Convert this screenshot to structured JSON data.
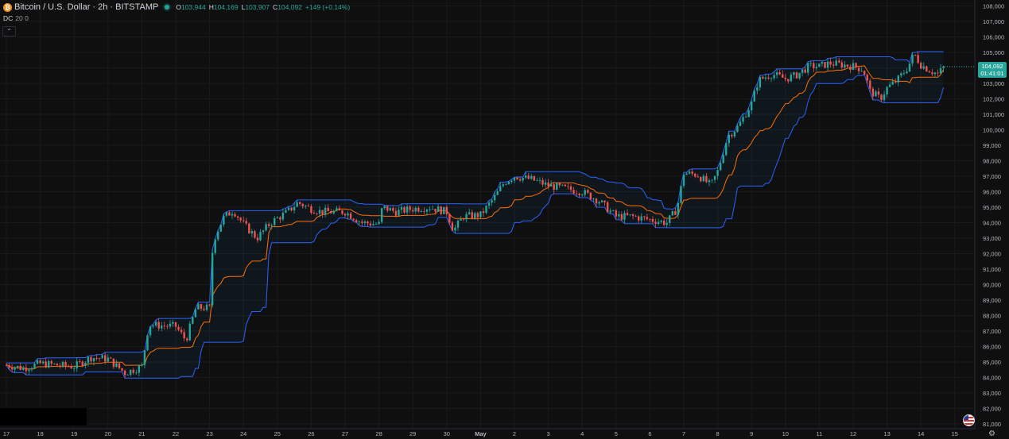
{
  "header": {
    "symbol_icon": "bitcoin-icon",
    "title": "Bitcoin / U.S. Dollar · 2h · BITSTAMP",
    "ohlc": [
      {
        "key": "O",
        "value": "103,944"
      },
      {
        "key": "H",
        "value": "104,169"
      },
      {
        "key": "L",
        "value": "103,907"
      },
      {
        "key": "C",
        "value": "104,092"
      }
    ],
    "change": "+149 (+0.14%)"
  },
  "indicator": {
    "name": "DC",
    "params": "20 0"
  },
  "controls": {
    "collapse_glyph": "⌃",
    "settings_icon": "gear-icon",
    "flag_icon": "us-flag-icon"
  },
  "price_tag": {
    "price": "104,092",
    "countdown": "01:41:01"
  },
  "colors": {
    "background": "#0f0f0f",
    "up": "#26a69a",
    "down": "#ef5350",
    "channel": "#2962ff",
    "basis": "#ff6d00",
    "fill": "rgba(33,150,243,0.06)"
  },
  "chart_data": {
    "type": "candlestick",
    "symbol": "Bitcoin / U.S. Dollar",
    "interval": "2h",
    "exchange": "BITSTAMP",
    "ylim": [
      81000,
      108000
    ],
    "y_ticks": [
      "81,000",
      "82,000",
      "83,000",
      "84,000",
      "85,000",
      "86,000",
      "87,000",
      "88,000",
      "89,000",
      "90,000",
      "91,000",
      "92,000",
      "93,000",
      "94,000",
      "95,000",
      "96,000",
      "97,000",
      "98,000",
      "99,000",
      "100,000",
      "101,000",
      "102,000",
      "103,000",
      "104,000",
      "105,000",
      "106,000",
      "107,000",
      "108,000"
    ],
    "x_ticks": [
      "17",
      "18",
      "19",
      "20",
      "21",
      "22",
      "23",
      "24",
      "25",
      "26",
      "27",
      "28",
      "29",
      "30",
      "May",
      "2",
      "3",
      "4",
      "5",
      "6",
      "7",
      "8",
      "9",
      "10",
      "11",
      "12",
      "13",
      "14",
      "15"
    ],
    "indicator": "Donchian Channels (20, 0)",
    "last_price": 104092,
    "closes_keypoints": [
      [
        0,
        84800
      ],
      [
        0.5,
        84600
      ],
      [
        1,
        84900
      ],
      [
        2,
        84700
      ],
      [
        2.5,
        85300
      ],
      [
        3,
        85200
      ],
      [
        3.5,
        84300
      ],
      [
        4,
        84700
      ],
      [
        4.2,
        87400
      ],
      [
        5,
        87300
      ],
      [
        5.3,
        86400
      ],
      [
        5.6,
        88500
      ],
      [
        6,
        88500
      ],
      [
        6.1,
        92800
      ],
      [
        6.4,
        94300
      ],
      [
        6.7,
        94800
      ],
      [
        7,
        93900
      ],
      [
        7.4,
        93000
      ],
      [
        7.8,
        94000
      ],
      [
        8.3,
        94700
      ],
      [
        8.6,
        95300
      ],
      [
        9,
        94900
      ],
      [
        9.3,
        94700
      ],
      [
        9.6,
        94700
      ],
      [
        10,
        94700
      ],
      [
        10.5,
        94000
      ],
      [
        11,
        93900
      ],
      [
        11.1,
        95000
      ],
      [
        11.5,
        94700
      ],
      [
        12,
        94900
      ],
      [
        12.5,
        95000
      ],
      [
        13,
        94700
      ],
      [
        13.2,
        93500
      ],
      [
        13.5,
        94400
      ],
      [
        14,
        94500
      ],
      [
        14.4,
        95600
      ],
      [
        14.7,
        96600
      ],
      [
        15,
        97000
      ],
      [
        15.5,
        96800
      ],
      [
        16,
        96400
      ],
      [
        16.5,
        96200
      ],
      [
        17,
        96000
      ],
      [
        17.5,
        95400
      ],
      [
        18,
        94400
      ],
      [
        18.5,
        94400
      ],
      [
        19,
        94200
      ],
      [
        19.5,
        94000
      ],
      [
        19.8,
        94900
      ],
      [
        20,
        97200
      ],
      [
        20.4,
        97100
      ],
      [
        20.8,
        96400
      ],
      [
        21,
        97300
      ],
      [
        21.3,
        99600
      ],
      [
        21.6,
        100200
      ],
      [
        22,
        101700
      ],
      [
        22.2,
        103200
      ],
      [
        22.6,
        103600
      ],
      [
        23,
        103300
      ],
      [
        23.3,
        103500
      ],
      [
        23.7,
        104100
      ],
      [
        24,
        104100
      ],
      [
        24.3,
        104300
      ],
      [
        24.7,
        104200
      ],
      [
        25,
        104100
      ],
      [
        25.3,
        103900
      ],
      [
        25.5,
        102500
      ],
      [
        25.8,
        102000
      ],
      [
        26,
        102700
      ],
      [
        26.3,
        103200
      ],
      [
        26.6,
        104000
      ],
      [
        26.8,
        104900
      ],
      [
        27,
        104200
      ],
      [
        27.3,
        103800
      ],
      [
        27.5,
        103600
      ],
      [
        27.7,
        104092
      ]
    ]
  }
}
